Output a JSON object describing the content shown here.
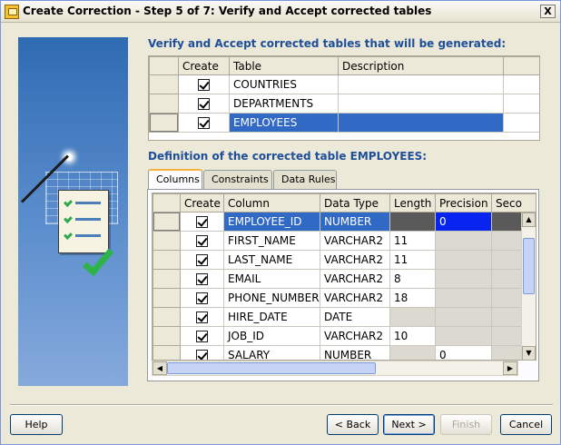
{
  "window": {
    "title": "Create Correction - Step 5 of 7: Verify and Accept corrected tables",
    "close_label": "X"
  },
  "sections": {
    "tables_title": "Verify and Accept corrected tables that will be generated:",
    "definition_title": "Definition of the corrected table EMPLOYEES:"
  },
  "tables_grid": {
    "headers": [
      "Create",
      "Table",
      "Description"
    ],
    "rows": [
      {
        "create": true,
        "table": "COUNTRIES",
        "description": ""
      },
      {
        "create": true,
        "table": "DEPARTMENTS",
        "description": ""
      },
      {
        "create": true,
        "table": "EMPLOYEES",
        "description": "",
        "selected": true
      }
    ]
  },
  "tabs": [
    {
      "label": "Columns",
      "active": true
    },
    {
      "label": "Constraints",
      "active": false
    },
    {
      "label": "Data Rules",
      "active": false
    }
  ],
  "columns_grid": {
    "headers": [
      "Create",
      "Column",
      "Data Type",
      "Length",
      "Precision",
      "Seco"
    ],
    "rows": [
      {
        "create": true,
        "column": "EMPLOYEE_ID",
        "data_type": "NUMBER",
        "length": "",
        "precision": "0",
        "selected": true
      },
      {
        "create": true,
        "column": "FIRST_NAME",
        "data_type": "VARCHAR2",
        "length": "11",
        "precision": ""
      },
      {
        "create": true,
        "column": "LAST_NAME",
        "data_type": "VARCHAR2",
        "length": "11",
        "precision": ""
      },
      {
        "create": true,
        "column": "EMAIL",
        "data_type": "VARCHAR2",
        "length": "8",
        "precision": ""
      },
      {
        "create": true,
        "column": "PHONE_NUMBER",
        "data_type": "VARCHAR2",
        "length": "18",
        "precision": ""
      },
      {
        "create": true,
        "column": "HIRE_DATE",
        "data_type": "DATE",
        "length": "",
        "precision": ""
      },
      {
        "create": true,
        "column": "JOB_ID",
        "data_type": "VARCHAR2",
        "length": "10",
        "precision": ""
      },
      {
        "create": true,
        "column": "SALARY",
        "data_type": "NUMBER",
        "length": "",
        "precision": "0"
      }
    ]
  },
  "buttons": {
    "help": "Help",
    "back": "< Back",
    "next": "Next >",
    "finish": "Finish",
    "cancel": "Cancel"
  },
  "colors": {
    "selection": "#316ac5",
    "section_title": "#1f4f9a"
  }
}
